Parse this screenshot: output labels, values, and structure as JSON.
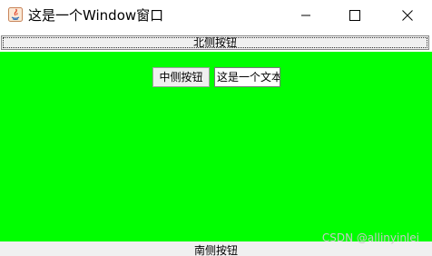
{
  "window": {
    "title": "这是一个Window窗口",
    "icon": "java-icon"
  },
  "north": {
    "label": "北侧按钮"
  },
  "center": {
    "button_label": "中侧按钮",
    "text_field_value": "这是一个文本",
    "background": "#00ff00"
  },
  "south": {
    "label": "南侧按钮"
  },
  "watermark": {
    "text": "CSDN @allinyinlei"
  }
}
